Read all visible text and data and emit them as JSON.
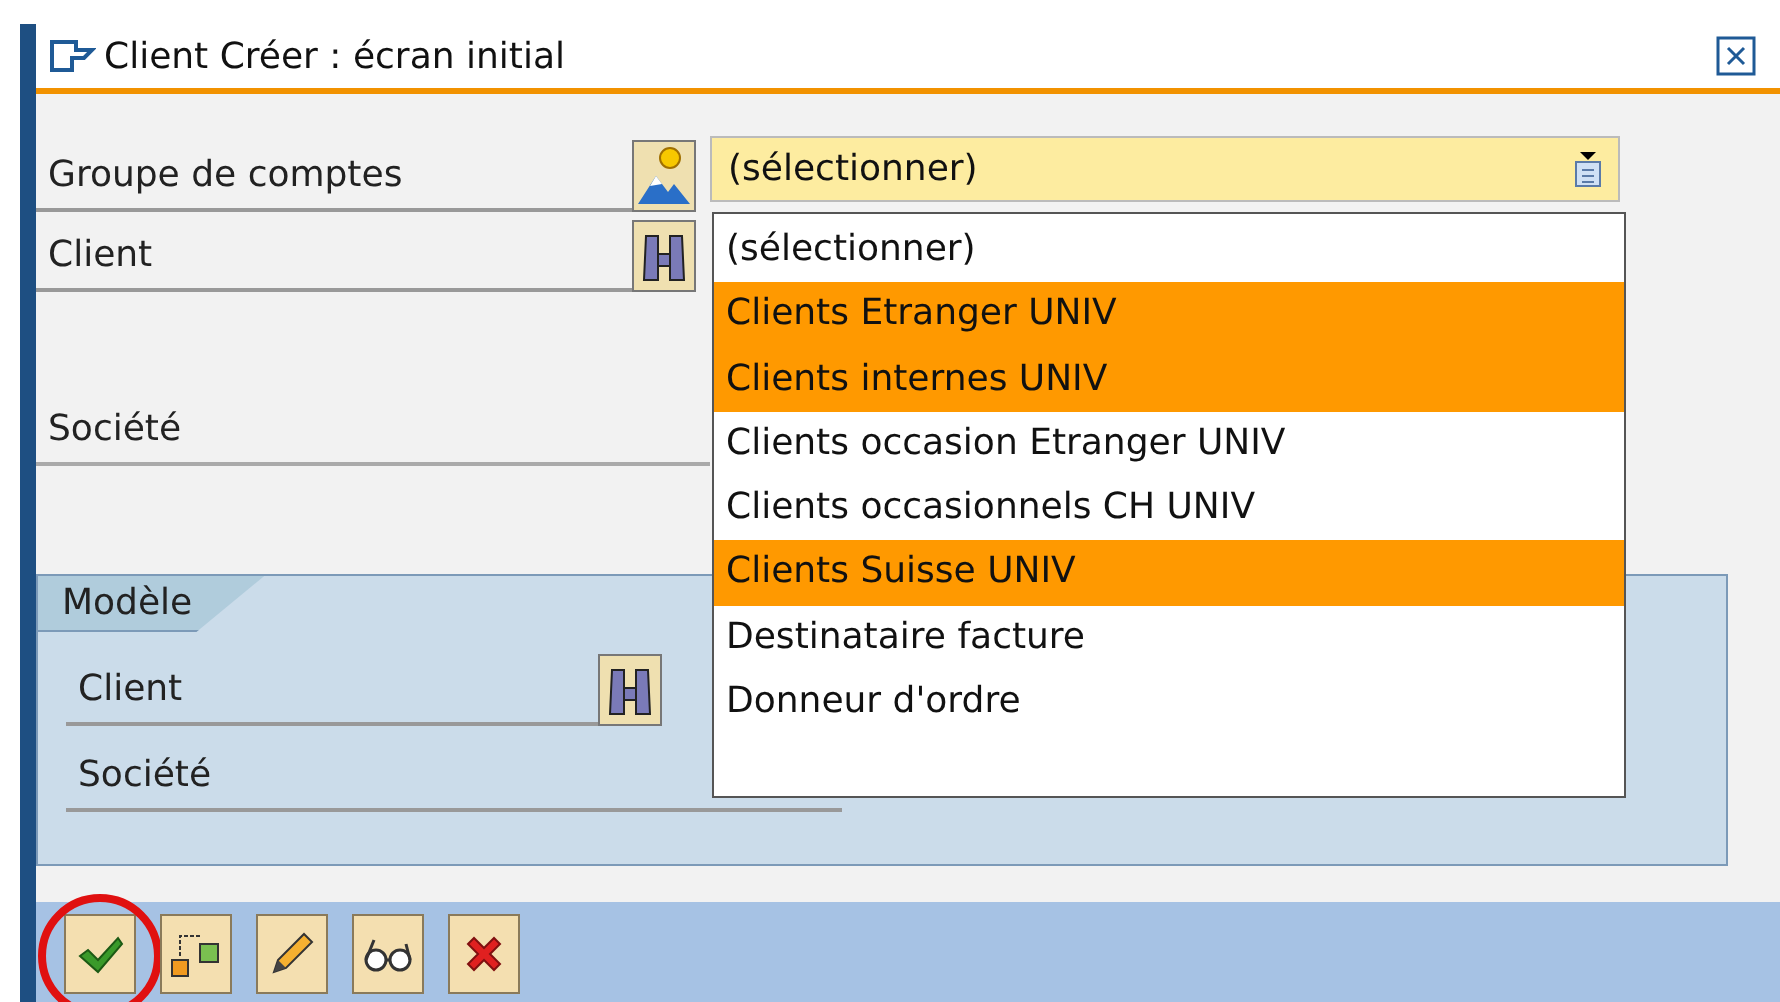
{
  "window": {
    "title": "Client Créer : écran initial"
  },
  "fields": [
    {
      "label": "Groupe de comptes",
      "kind": "combo",
      "value": "(sélectionner)"
    },
    {
      "label": "Client",
      "kind": "search"
    },
    {
      "label": "Société",
      "kind": "plain"
    }
  ],
  "dropdown": {
    "options": [
      {
        "label": "(sélectionner)",
        "selected": false
      },
      {
        "label": "Clients Etranger UNIV",
        "selected": true
      },
      {
        "label": "Clients internes UNIV",
        "selected": true
      },
      {
        "label": "Clients occasion Etranger UNIV",
        "selected": false
      },
      {
        "label": "Clients occasionnels CH UNIV",
        "selected": false
      },
      {
        "label": "Clients Suisse UNIV",
        "selected": true
      },
      {
        "label": "Destinataire facture",
        "selected": false
      },
      {
        "label": "Donneur d'ordre",
        "selected": false
      }
    ]
  },
  "template_group": {
    "title": "Modèle",
    "fields": [
      {
        "label": "Client",
        "kind": "search"
      },
      {
        "label": "Société",
        "kind": "plain"
      }
    ]
  },
  "toolbar": [
    {
      "kind": "check",
      "highlighted": true
    },
    {
      "kind": "hierarchy",
      "highlighted": false
    },
    {
      "kind": "pencil",
      "highlighted": false
    },
    {
      "kind": "glasses",
      "highlighted": false
    },
    {
      "kind": "cancel",
      "highlighted": false
    }
  ]
}
